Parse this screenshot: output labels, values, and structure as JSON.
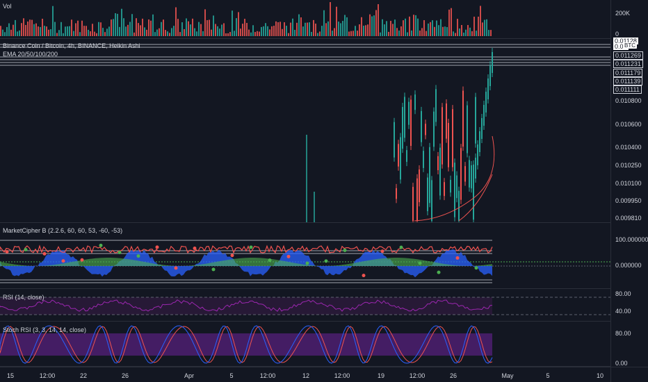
{
  "volume": {
    "title": "Vol",
    "axis_labels": [
      "200K",
      "0"
    ]
  },
  "price": {
    "title": "Binance Coin / Bitcoin, 4h, BINANCE, Heikin Ashi",
    "ema_title": "EMA 20/50/100/200",
    "currency_tag": "BTC",
    "axis_labels": [
      "0.011269",
      "0.011231",
      "0.011179",
      "0.011139",
      "0.011111",
      "0.010800",
      "0.010600",
      "0.010400",
      "0.010250",
      "0.010100",
      "0.009950",
      "0.009810"
    ],
    "current_labels": [
      "0.01128",
      "0.01"
    ]
  },
  "market_cipher": {
    "title": "MarketCipher B (2.2.6, 60, 60, 53, -60, -53)",
    "axis_labels": [
      "100.000000",
      "0.000000"
    ]
  },
  "rsi": {
    "title": "RSI (14, close)",
    "axis_labels": [
      "80.00",
      "40.00"
    ]
  },
  "stoch_rsi": {
    "title": "Stoch RSI (3, 3, 14, 14, close)",
    "axis_labels": [
      "80.00",
      "0.00"
    ]
  },
  "time_axis": {
    "labels": [
      "15",
      "12:00",
      "22",
      "26",
      "Apr",
      "5",
      "12:00",
      "12",
      "12:00",
      "19",
      "12:00",
      "26",
      "May",
      "5",
      "10"
    ]
  },
  "colors": {
    "up": "#26a69a",
    "down": "#ef5350",
    "background": "#131722",
    "wave_blue": "#2962ff",
    "money_flow_green": "#4caf50",
    "rsi_line": "#9c27b0",
    "stoch_k": "#2962ff",
    "stoch_d": "#ef5350",
    "stoch_band": "#4a1e6b"
  }
}
